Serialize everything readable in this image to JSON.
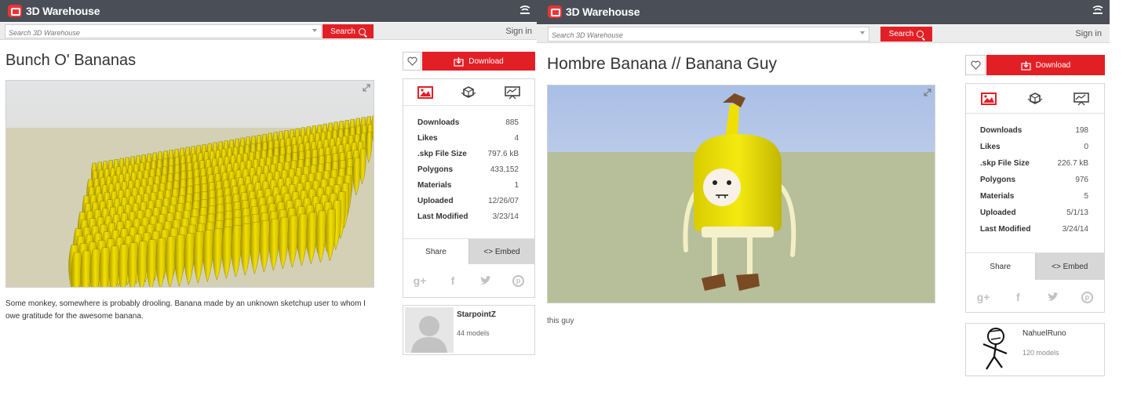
{
  "colors": {
    "topbar": "#4a4e57",
    "accent_red": "#e31f26",
    "embed_tab": "#d7d7d7",
    "banana_yellow": "#f2e000"
  },
  "panels": [
    {
      "header": {
        "brand": "3D Warehouse",
        "menu_icon": "wifi-menu-icon"
      },
      "search": {
        "placeholder": "Search 3D Warehouse",
        "button_label": "Search",
        "signin_label": "Sign in"
      },
      "model": {
        "title": "Bunch O' Bananas",
        "description": "Some monkey, somewhere is probably drooling. Banana made by an unknown sketchup user to whom I owe gratitude for the awesome banana.",
        "download_label": "Download",
        "stats": [
          {
            "label": "Downloads",
            "value": "885"
          },
          {
            "label": "Likes",
            "value": "4"
          },
          {
            "label": ".skp File Size",
            "value": "797.6 kB"
          },
          {
            "label": "Polygons",
            "value": "433,152"
          },
          {
            "label": "Materials",
            "value": "1"
          },
          {
            "label": "Uploaded",
            "value": "12/26/07"
          },
          {
            "label": "Last Modified",
            "value": "3/23/14"
          }
        ],
        "share_label": "Share",
        "embed_label": "<> Embed",
        "social_icons": [
          "google-plus-icon",
          "facebook-icon",
          "twitter-icon",
          "pinterest-icon"
        ],
        "author": {
          "name": "StarpointZ",
          "models": "44 models"
        }
      }
    },
    {
      "header": {
        "brand": "3D Warehouse",
        "menu_icon": "wifi-menu-icon"
      },
      "search": {
        "placeholder": "Search 3D Warehouse",
        "button_label": "Search",
        "signin_label": "Sign in"
      },
      "model": {
        "title": "Hombre Banana // Banana Guy",
        "description": "this guy",
        "download_label": "Download",
        "stats": [
          {
            "label": "Downloads",
            "value": "198"
          },
          {
            "label": "Likes",
            "value": "0"
          },
          {
            "label": ".skp File Size",
            "value": "226.7 kB"
          },
          {
            "label": "Polygons",
            "value": "976"
          },
          {
            "label": "Materials",
            "value": "5"
          },
          {
            "label": "Uploaded",
            "value": "5/1/13"
          },
          {
            "label": "Last Modified",
            "value": "3/24/14"
          }
        ],
        "share_label": "Share",
        "embed_label": "<> Embed",
        "social_icons": [
          "google-plus-icon",
          "facebook-icon",
          "twitter-icon",
          "pinterest-icon"
        ],
        "author": {
          "name": "NahuelRuno",
          "models": "120 models"
        }
      }
    }
  ]
}
